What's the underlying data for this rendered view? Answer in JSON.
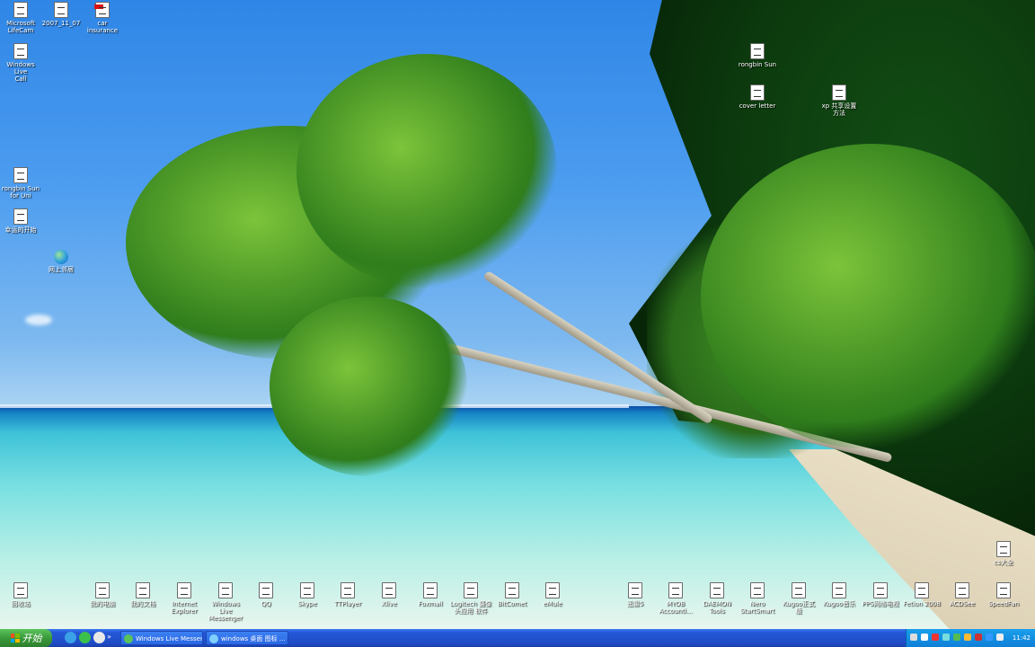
{
  "desktop": {
    "icons": [
      {
        "name": "icon-microsoft-lifecam",
        "label": "Microsoft\nLifeCam",
        "kind": "doc"
      },
      {
        "name": "icon-2007-11-07",
        "label": "2007_11_07",
        "kind": "doc"
      },
      {
        "name": "icon-car-insurance",
        "label": "car insurance",
        "kind": "pdf"
      },
      {
        "name": "icon-windows-live-call",
        "label": "Windows Live\nCall",
        "kind": "doc"
      },
      {
        "name": "icon-rongbin-sun",
        "label": "rongbin Sun",
        "kind": "doc"
      },
      {
        "name": "icon-cover-letter",
        "label": "cover letter",
        "kind": "doc"
      },
      {
        "name": "icon-xp-sharing",
        "label": "xp 共享设置\n方法",
        "kind": "doc"
      },
      {
        "name": "icon-rongbin-sun-for-uni",
        "label": "rongbin Sun\nfor Uni",
        "kind": "doc"
      },
      {
        "name": "icon-lucky-start",
        "label": "幸运的开始",
        "kind": "doc"
      },
      {
        "name": "icon-network-neighborhood",
        "label": "网上邻居",
        "kind": "globe"
      },
      {
        "name": "icon-recycle-bin",
        "label": "回收站",
        "kind": "doc"
      },
      {
        "name": "icon-my-computer",
        "label": "我的电脑",
        "kind": "doc"
      },
      {
        "name": "icon-my-documents",
        "label": "我的文档",
        "kind": "doc"
      },
      {
        "name": "icon-internet-explorer",
        "label": "Internet\nExplorer",
        "kind": "doc"
      },
      {
        "name": "icon-windows-live-messenger",
        "label": "Windows Live\nMessenger",
        "kind": "doc"
      },
      {
        "name": "icon-qq",
        "label": "QQ",
        "kind": "doc"
      },
      {
        "name": "icon-skype",
        "label": "Skype",
        "kind": "doc"
      },
      {
        "name": "icon-ttplayer",
        "label": "TTPlayer",
        "kind": "doc"
      },
      {
        "name": "icon-xlive",
        "label": "Xlive",
        "kind": "doc"
      },
      {
        "name": "icon-foxmail",
        "label": "Foxmail",
        "kind": "doc"
      },
      {
        "name": "icon-logitech-webcam",
        "label": "Logitech 摄像\n头应用 软件",
        "kind": "doc"
      },
      {
        "name": "icon-bitcomet",
        "label": "BitComet",
        "kind": "doc"
      },
      {
        "name": "icon-emule",
        "label": "eMule",
        "kind": "doc"
      },
      {
        "name": "icon-thunder",
        "label": "迅雷5",
        "kind": "doc"
      },
      {
        "name": "icon-myob-accounting",
        "label": "MYOB\nAccounti...",
        "kind": "doc"
      },
      {
        "name": "icon-daemon-tools",
        "label": "DAEMON Tools",
        "kind": "doc"
      },
      {
        "name": "icon-nero-startsmart",
        "label": "Nero\nStartSmart",
        "kind": "doc"
      },
      {
        "name": "icon-kugoo-official",
        "label": "Kugoo正式\n版",
        "kind": "doc"
      },
      {
        "name": "icon-kugoo-music",
        "label": "Kugoo音乐",
        "kind": "doc"
      },
      {
        "name": "icon-pps-tv",
        "label": "PPS网络电视",
        "kind": "doc"
      },
      {
        "name": "icon-fetion-2008",
        "label": "Fetion 2008",
        "kind": "doc"
      },
      {
        "name": "icon-acdsee",
        "label": "ACDSee",
        "kind": "doc"
      },
      {
        "name": "icon-speedfan",
        "label": "SpeedFan",
        "kind": "doc"
      },
      {
        "name": "icon-cs-folder",
        "label": "cs大全",
        "kind": "doc"
      }
    ]
  },
  "taskbar": {
    "start_label": "开始",
    "tasks": [
      {
        "label": "Windows Live Messen..."
      },
      {
        "label": "windows 桌面 图标 ..."
      }
    ],
    "clock": "11:42"
  }
}
